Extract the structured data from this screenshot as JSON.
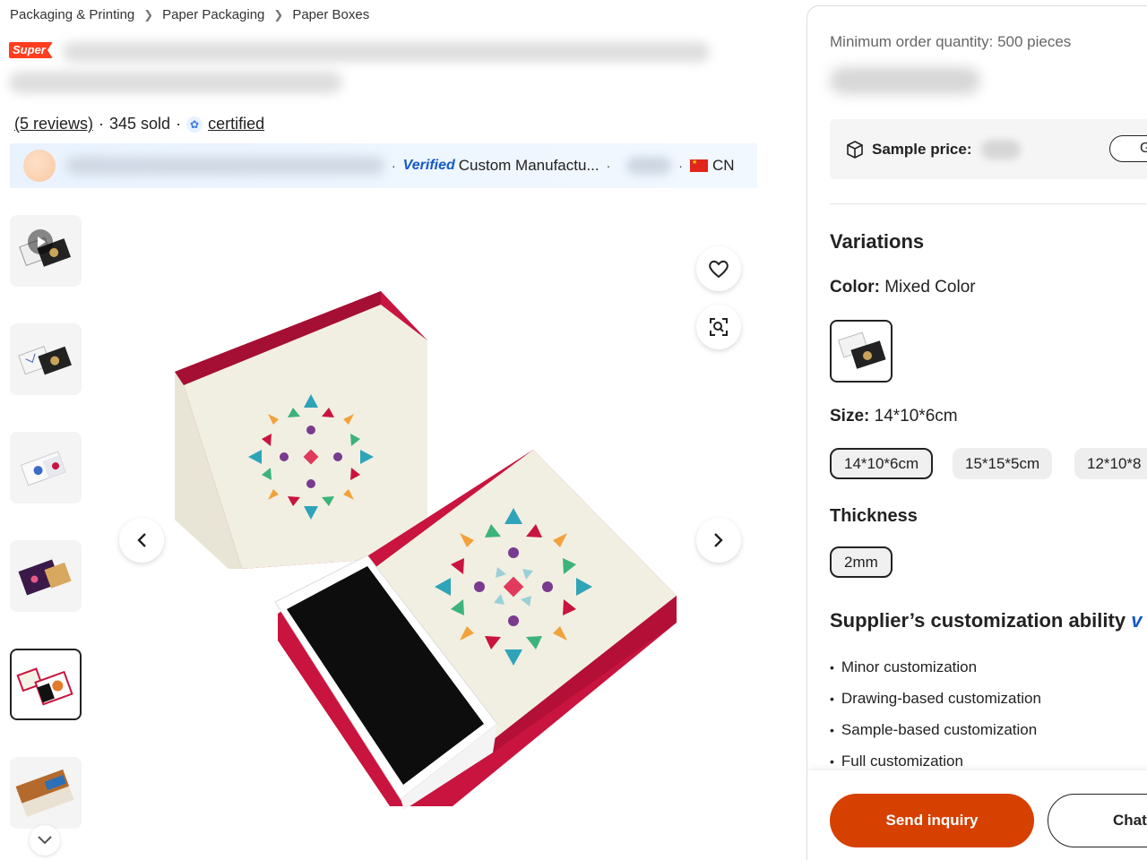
{
  "breadcrumb": [
    "Packaging & Printing",
    "Paper Packaging",
    "Paper Boxes"
  ],
  "product": {
    "badge": "Super",
    "reviews_text": "(5 reviews)",
    "sold_text": "345 sold",
    "certified_text": "certified"
  },
  "supplier": {
    "verified_label": "Verified",
    "type_text": "Custom Manufactu...",
    "country": "CN"
  },
  "image_controls": {
    "prev_icon": "chevron-left-icon",
    "next_icon": "chevron-right-icon",
    "favorite_icon": "heart-icon",
    "visual_search_icon": "image-search-icon"
  },
  "right_panel": {
    "moq": "Minimum order quantity: 500 pieces",
    "sample_label": "Sample price:",
    "sample_button": "G",
    "variations_title": "Variations",
    "color_label": "Color:",
    "color_value": "Mixed Color",
    "size_label": "Size:",
    "size_value": "14*10*6cm",
    "sizes": [
      "14*10*6cm",
      "15*15*5cm",
      "12*10*8"
    ],
    "thickness_title": "Thickness",
    "thickness_options": [
      "2mm"
    ],
    "customization_title": "Supplier’s customization ability",
    "customization_items": [
      "Minor customization",
      "Drawing-based customization",
      "Sample-based customization",
      "Full customization"
    ],
    "send_inquiry": "Send inquiry",
    "chat": "Chat"
  },
  "colors": {
    "accent": "#d64000",
    "super_badge": "#ff3d1f",
    "verified_blue": "#1659c7",
    "box_red": "#c8143e"
  }
}
